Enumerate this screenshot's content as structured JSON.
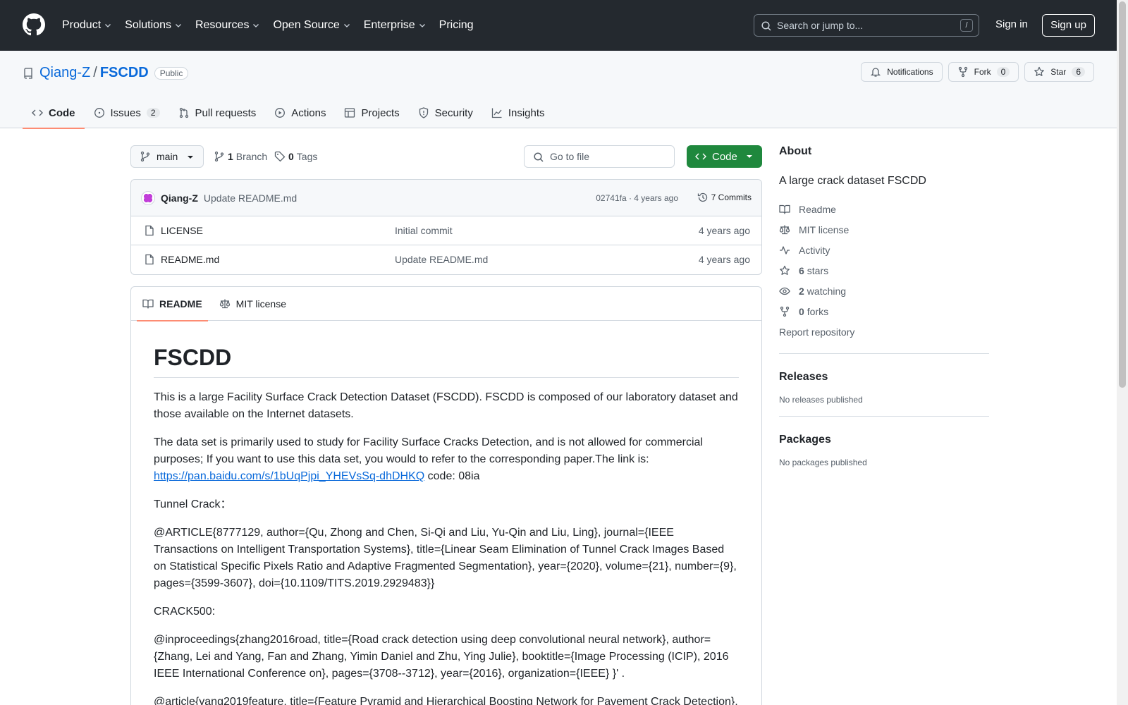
{
  "header": {
    "nav": [
      "Product",
      "Solutions",
      "Resources",
      "Open Source",
      "Enterprise",
      "Pricing"
    ],
    "search_placeholder": "Search or jump to...",
    "search_key": "/",
    "sign_in": "Sign in",
    "sign_up": "Sign up"
  },
  "repo": {
    "owner": "Qiang-Z",
    "separator": "/",
    "name": "FSCDD",
    "visibility": "Public",
    "notifications_label": "Notifications",
    "fork_label": "Fork",
    "fork_count": "0",
    "star_label": "Star",
    "star_count": "6",
    "tabs": [
      {
        "label": "Code",
        "count": ""
      },
      {
        "label": "Issues",
        "count": "2"
      },
      {
        "label": "Pull requests",
        "count": ""
      },
      {
        "label": "Actions",
        "count": ""
      },
      {
        "label": "Projects",
        "count": ""
      },
      {
        "label": "Security",
        "count": ""
      },
      {
        "label": "Insights",
        "count": ""
      }
    ]
  },
  "file_nav": {
    "branch": "main",
    "branch_count": "1",
    "branch_label": "Branch",
    "tag_count": "0",
    "tag_label": "Tags",
    "goto_placeholder": "Go to file",
    "code_button": "Code"
  },
  "latest_commit": {
    "author": "Qiang-Z",
    "message": "Update README.md",
    "meta": "02741fa · 4 years ago",
    "commits": "7 Commits"
  },
  "files": [
    {
      "name": "LICENSE",
      "commit": "Initial commit",
      "time": "4 years ago"
    },
    {
      "name": "README.md",
      "commit": "Update README.md",
      "time": "4 years ago"
    }
  ],
  "readme": {
    "tab_readme": "README",
    "tab_license": "MIT license",
    "title": "FSCDD",
    "p1": "This is a large Facility Surface Crack Detection Dataset (FSCDD). FSCDD is composed of our laboratory dataset and those available on the Internet datasets.",
    "p2": "The data set is primarily used to study for Facility Surface Cracks Detection, and is not allowed for commercial purposes; If you want to use this data set, you would to refer to the corresponding paper.The link is:",
    "link": "https://pan.baidu.com/s/1bUqPjpi_YHEVsSq-dhDHKQ",
    "link_code": " code: 08ia",
    "p3": "Tunnel Crack：",
    "p4": "@ARTICLE{8777129, author={Qu, Zhong and Chen, Si-Qi and Liu, Yu-Qin and Liu, Ling}, journal={IEEE Transactions on Intelligent Transportation Systems}, title={Linear Seam Elimination of Tunnel Crack Images Based on Statistical Specific Pixels Ratio and Adaptive Fragmented Segmentation}, year={2020}, volume={21}, number={9}, pages={3599-3607}, doi={10.1109/TITS.2019.2929483}}",
    "p5": "CRACK500:",
    "p6": "@inproceedings{zhang2016road, title={Road crack detection using deep convolutional neural network}, author={Zhang, Lei and Yang, Fan and Zhang, Yimin Daniel and Zhu, Ying Julie}, booktitle={Image Processing (ICIP), 2016 IEEE International Conference on}, pages={3708--3712}, year={2016}, organization={IEEE} }' .",
    "p7": "@article{yang2019feature, title={Feature Pyramid and Hierarchical Boosting Network for Pavement Crack Detection},"
  },
  "about": {
    "heading": "About",
    "description": "A large crack dataset FSCDD",
    "readme": "Readme",
    "license": "MIT license",
    "activity": "Activity",
    "stars_count": "6",
    "stars_label": "stars",
    "watching_count": "2",
    "watching_label": "watching",
    "forks_count": "0",
    "forks_label": "forks",
    "report": "Report repository"
  },
  "releases": {
    "heading": "Releases",
    "note": "No releases published"
  },
  "packages": {
    "heading": "Packages",
    "note": "No packages published"
  }
}
